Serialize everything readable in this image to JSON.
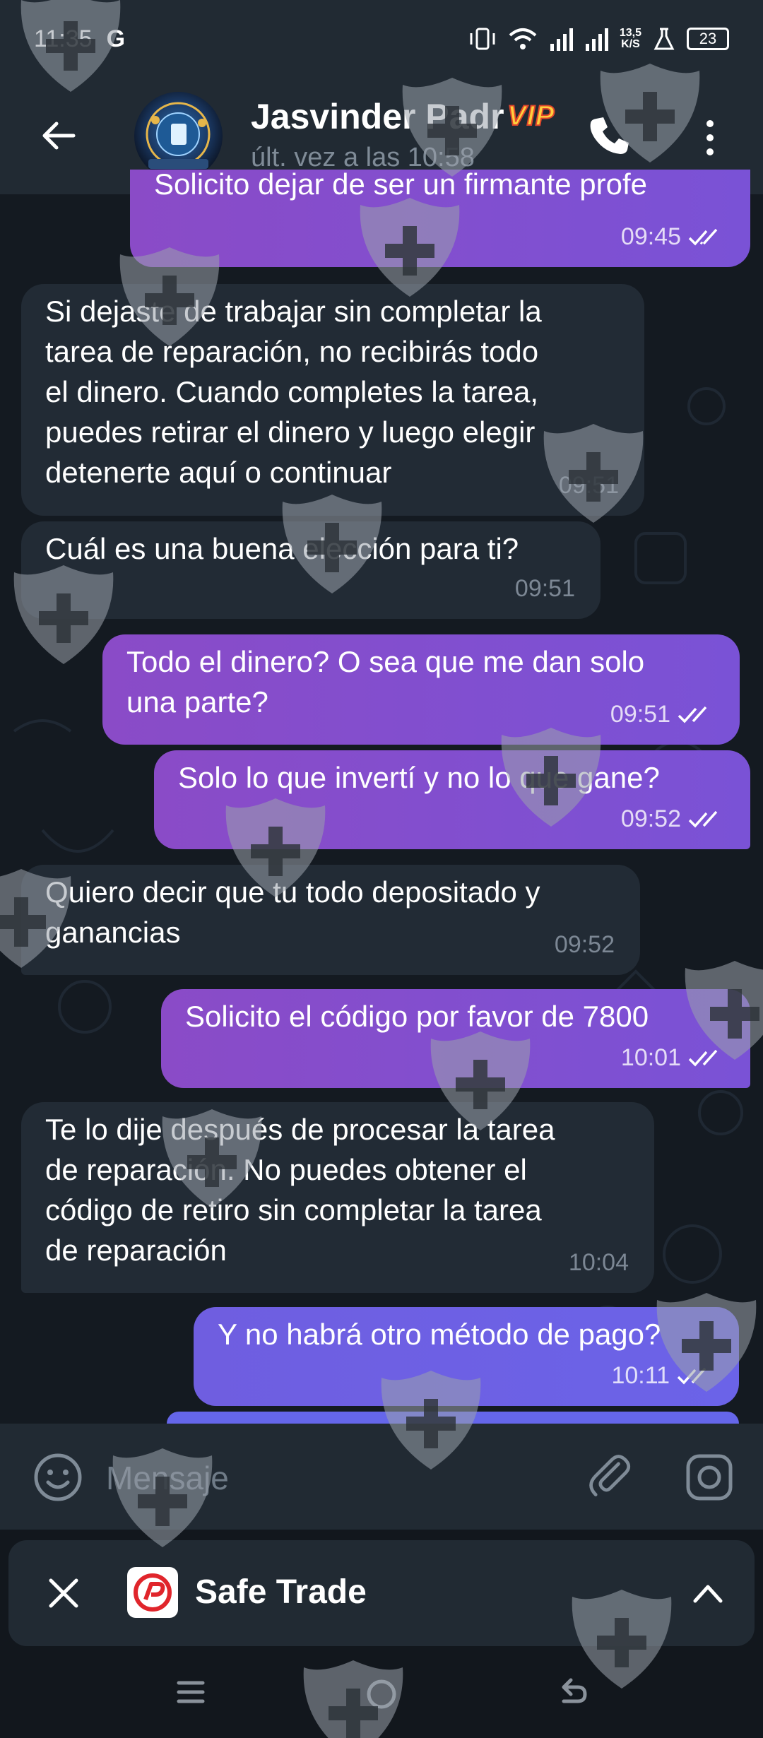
{
  "status_bar": {
    "time": "11:35",
    "carrier_icon": "G",
    "net_speed_top": "13,5",
    "net_speed_bottom": "K/S",
    "battery": "23"
  },
  "header": {
    "contact_name": "Jasvinder Padr",
    "badge": "VIP",
    "last_seen": "últ. vez a las 10:58"
  },
  "messages": [
    {
      "dir": "out",
      "text": "Solicito dejar de ser un firmante profe",
      "time": "09:45",
      "read": true
    },
    {
      "dir": "in",
      "text": "Si dejaste de trabajar sin completar la\ntarea de reparación, no recibirás todo\nel dinero. Cuando completes la tarea,\npuedes retirar el dinero y luego elegir\ndetenerte aquí o continuar",
      "time": "09:51"
    },
    {
      "dir": "in",
      "text": "Cuál es una buena elección para ti?",
      "time": "09:51"
    },
    {
      "dir": "out",
      "text": "Todo el dinero? O sea que me dan solo\nuna parte?",
      "time": "09:51",
      "read": true
    },
    {
      "dir": "out",
      "text": "Solo lo que invertí y no lo que gane?",
      "time": "09:52",
      "read": true
    },
    {
      "dir": "in",
      "text": "Quiero decir que tu todo depositado y\nganancias",
      "time": "09:52"
    },
    {
      "dir": "out",
      "text": "Solicito el código por favor de 7800",
      "time": "10:01",
      "read": true
    },
    {
      "dir": "in",
      "text": "Te lo dije después de procesar la tarea\nde reparación. No puedes obtener el\ncódigo de retiro sin completar la tarea\nde reparación",
      "time": "10:04"
    },
    {
      "dir": "out",
      "text": "Y no habrá otro método de pago?",
      "time": "10:11",
      "read": true
    }
  ],
  "input": {
    "placeholder": "Mensaje"
  },
  "pip": {
    "app_name": "Safe Trade"
  },
  "icons": {
    "back": "arrow-left-icon",
    "call": "phone-icon",
    "menu": "more-vertical-icon",
    "emoji": "smiley-icon",
    "attach": "paperclip-icon",
    "camera": "camera-icon",
    "close": "close-icon",
    "expand": "chevron-up-icon"
  },
  "colors": {
    "header_bg": "#212a33",
    "incoming_bubble": "#222b35",
    "outgoing_bubble": "#7a52d6",
    "vip_badge": "#ffcf3d"
  }
}
